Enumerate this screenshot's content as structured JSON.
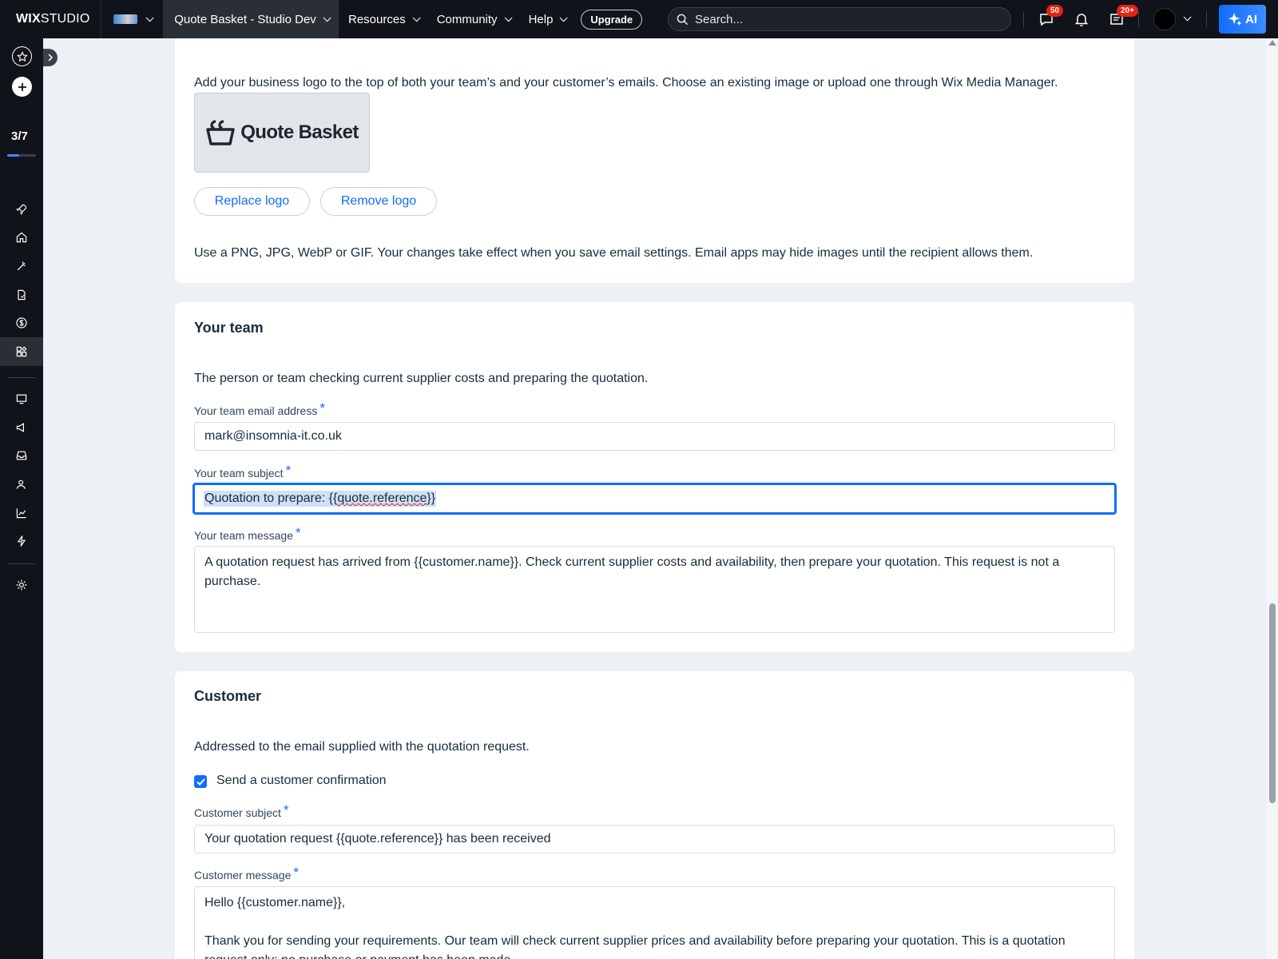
{
  "topbar": {
    "logo_bold": "WIX",
    "logo_rest": "STUDIO",
    "project": "Quote Basket - Studio Dev",
    "menu": [
      "Resources",
      "Community",
      "Help"
    ],
    "upgrade": "Upgrade",
    "search_placeholder": "Search...",
    "messages_badge": "50",
    "inbox_badge": "20+",
    "ai_label": "AI",
    "accent": "#116dff"
  },
  "rail": {
    "step": "3/7",
    "progress": 0.43
  },
  "logo_section": {
    "description": "Add your business logo to the top of both your team’s and your customer’s emails. Choose an existing image or upload one through Wix Media Manager.",
    "logo_text": "Quote Basket",
    "replace_label": "Replace logo",
    "remove_label": "Remove logo",
    "note": "Use a PNG, JPG, WebP or GIF. Your changes take effect when you save email settings. Email apps may hide images until the recipient allows them."
  },
  "team": {
    "title": "Your team",
    "description": "The person or team checking current supplier costs and preparing the quotation.",
    "email_label": "Your team email address",
    "email_value": "mark@insomnia-it.co.uk",
    "subject_label": "Your team subject",
    "subject_value_prefix": "Quotation to prepare: {{",
    "subject_value_spell": "quote.reference",
    "subject_value_suffix": "}}",
    "message_label": "Your team message",
    "message_value": "A quotation request has arrived from {{customer.name}}. Check current supplier costs and availability, then prepare your quotation. This request is not a purchase."
  },
  "customer": {
    "title": "Customer",
    "description": "Addressed to the email supplied with the quotation request.",
    "confirm_label": "Send a customer confirmation",
    "confirm_checked": true,
    "subject_label": "Customer subject",
    "subject_value": "Your quotation request {{quote.reference}} has been received",
    "message_label": "Customer message",
    "message_value": "Hello {{customer.name}},\n\nThank you for sending your requirements. Our team will check current supplier prices and availability before preparing your quotation. This is a quotation request only; no purchase or payment has been made."
  }
}
